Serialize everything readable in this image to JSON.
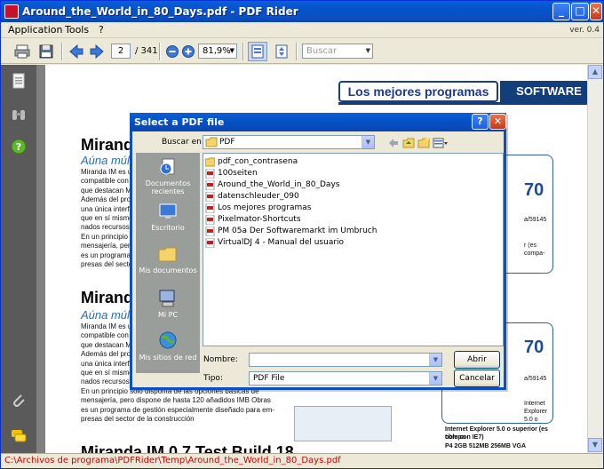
{
  "window": {
    "title": "Around_the_World_in_80_Days.pdf - PDF Rider"
  },
  "menu": {
    "items": [
      "Application",
      "Tools",
      "?"
    ],
    "version": "ver. 0.4"
  },
  "toolbar": {
    "page_current": "2",
    "page_total": "/ 341",
    "zoom": "81,9%",
    "search_placeholder": "Buscar"
  },
  "status": {
    "path": "C:\\Archivos de programa\\PDFRider\\Temp\\Around_the_World_in_80_Days.pdf"
  },
  "document": {
    "header_box": "Los mejores programas",
    "header_software": "SOFTWARE",
    "article1": {
      "title": "Miranda",
      "subtitle": "Aúna múltip",
      "body": [
        "Miranda IM es ur",
        "compatible con la",
        "que destacan MSN",
        "Además del propi",
        "una única interfaz",
        "que en sí mismo y",
        "nados recursos.",
        "En un principio s",
        "mensajería, pero c",
        "es un programa de",
        "presas del sector d"
      ]
    },
    "card1": {
      "number": "70",
      "spec1": "a/59145",
      "spec2": "r (es compa-"
    },
    "article2": {
      "title": "Miranda",
      "subtitle": "Aúna múltip",
      "body": [
        "Miranda IM es ur",
        "compatible con la",
        "que destacan MSN",
        "Además del propi",
        "una única interfaz",
        "que en sí mismo y",
        "nados recursos.",
        "En un principio sólo disponía de las opciones básicas de",
        "mensajería, pero dispone de hasta 120 añadidos IMB Obras",
        "es un programa de gestión especialmente diseñado para em-",
        "presas del sector de la construcción"
      ]
    },
    "card2": {
      "number": "70",
      "spec1": "a/59145",
      "spec2": "Internet Explorer 5.0 o superior (es compa-",
      "spec3": "tible con IE7)",
      "spec4": "P4 2GB 512MB 256MB VGA"
    },
    "article3": {
      "title": "Miranda IM 0.7 Test Build 18"
    }
  },
  "dialog": {
    "title": "Select a PDF file",
    "look_in_label": "Buscar en:",
    "look_in_value": "PDF",
    "places": [
      "Documentos recientes",
      "Escritorio",
      "Mis documentos",
      "Mi PC",
      "Mis sitios de red"
    ],
    "files": [
      {
        "name": "pdf_con_contrasena",
        "type": "folder"
      },
      {
        "name": "100seiten",
        "type": "pdf"
      },
      {
        "name": "Around_the_World_in_80_Days",
        "type": "pdf"
      },
      {
        "name": "datenschleuder_090",
        "type": "pdf"
      },
      {
        "name": "Los mejores programas",
        "type": "pdf"
      },
      {
        "name": "Pixelmator-Shortcuts",
        "type": "pdf"
      },
      {
        "name": "PM 05a Der Softwaremarkt im Umbruch",
        "type": "pdf"
      },
      {
        "name": "VirtualDJ 4 - Manual del usuario",
        "type": "pdf"
      }
    ],
    "name_label": "Nombre:",
    "name_value": "",
    "type_label": "Tipo:",
    "type_value": "PDF File",
    "open_button": "Abrir",
    "cancel_button": "Cancelar"
  }
}
